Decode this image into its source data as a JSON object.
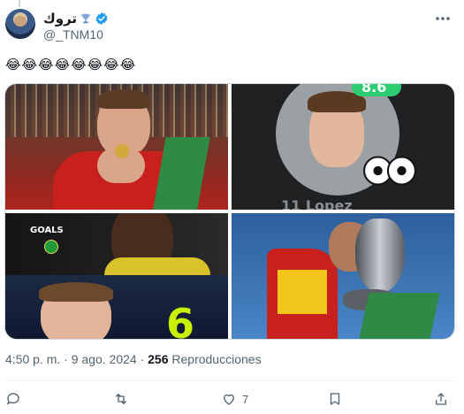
{
  "tweet": {
    "display_name": "تروك",
    "handle": "@_TNM10",
    "text": "😂😂😂😂😂😂😂😂",
    "media_captions": {
      "rating": "8.6",
      "player_name": "11 Lopez",
      "goals_label": "GOALS",
      "goals_count": "6"
    },
    "time": "4:50 p. m.",
    "dot": "·",
    "date": "9 ago. 2024",
    "views_count": "256",
    "views_label": "Reproducciones",
    "likes_count": "7"
  },
  "colors": {
    "verified_blue": "#1d9bf0",
    "muted": "#536471",
    "rating_green": "#2ecc71",
    "goals_green": "#c8f000"
  }
}
